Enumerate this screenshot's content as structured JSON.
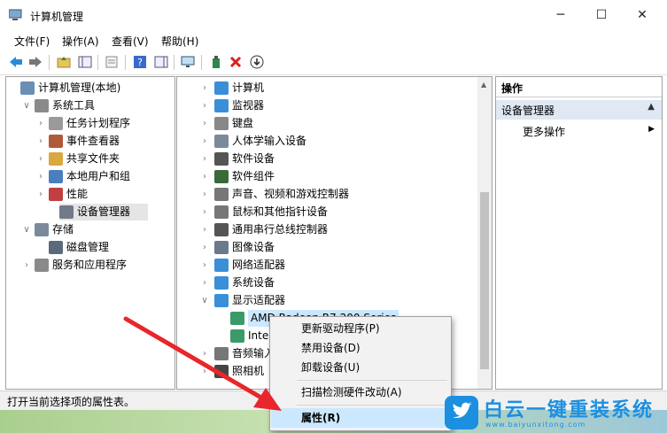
{
  "window": {
    "title": "计算机管理",
    "minimize": "─",
    "maximize": "☐",
    "close": "✕"
  },
  "menus": [
    "文件(F)",
    "操作(A)",
    "查看(V)",
    "帮助(H)"
  ],
  "toolbar": {
    "icons": [
      "back-icon",
      "forward-icon",
      "up-folder-icon",
      "show-tree-icon",
      "properties-icon",
      "help-icon",
      "show-pane-icon",
      "monitor-icon",
      "scan-hardware-icon",
      "delete-icon",
      "download-icon"
    ]
  },
  "tree": [
    {
      "label": "计算机管理(本地)",
      "level": 0,
      "expander": "",
      "icon": "computer-management-icon",
      "color": "#6a8fb5"
    },
    {
      "label": "系统工具",
      "level": 1,
      "expander": "∨",
      "icon": "tools-icon",
      "color": "#8a8a8a"
    },
    {
      "label": "任务计划程序",
      "level": 2,
      "expander": "›",
      "icon": "clock-icon",
      "color": "#9a9a9a"
    },
    {
      "label": "事件查看器",
      "level": 2,
      "expander": "›",
      "icon": "event-viewer-icon",
      "color": "#b05a3a"
    },
    {
      "label": "共享文件夹",
      "level": 2,
      "expander": "›",
      "icon": "shared-folder-icon",
      "color": "#d9a841"
    },
    {
      "label": "本地用户和组",
      "level": 2,
      "expander": "›",
      "icon": "users-icon",
      "color": "#4a7fbf"
    },
    {
      "label": "性能",
      "level": 2,
      "expander": "›",
      "icon": "performance-icon",
      "color": "#c04040"
    },
    {
      "label": "设备管理器",
      "level": 2,
      "expander": "",
      "icon": "device-manager-icon",
      "color": "#707a88",
      "selected": true
    },
    {
      "label": "存储",
      "level": 1,
      "expander": "∨",
      "icon": "storage-icon",
      "color": "#7a8a9a"
    },
    {
      "label": "磁盘管理",
      "level": 2,
      "expander": "",
      "icon": "disk-icon",
      "color": "#5a6a7a"
    },
    {
      "label": "服务和应用程序",
      "level": 1,
      "expander": "›",
      "icon": "services-icon",
      "color": "#8a8a8a"
    }
  ],
  "devices": [
    {
      "label": "计算机",
      "expander": "›",
      "icon": "computer-icon",
      "color": "#3a8fd8",
      "indent": 0
    },
    {
      "label": "监视器",
      "expander": "›",
      "icon": "monitor-icon",
      "color": "#3a8fd8",
      "indent": 0
    },
    {
      "label": "键盘",
      "expander": "›",
      "icon": "keyboard-icon",
      "color": "#888",
      "indent": 0
    },
    {
      "label": "人体学输入设备",
      "expander": "›",
      "icon": "hid-icon",
      "color": "#7a8a9a",
      "indent": 0
    },
    {
      "label": "软件设备",
      "expander": "›",
      "icon": "software-device-icon",
      "color": "#555",
      "indent": 0
    },
    {
      "label": "软件组件",
      "expander": "›",
      "icon": "software-component-icon",
      "color": "#3a6a3a",
      "indent": 0
    },
    {
      "label": "声音、视频和游戏控制器",
      "expander": "›",
      "icon": "speaker-icon",
      "color": "#777",
      "indent": 0
    },
    {
      "label": "鼠标和其他指针设备",
      "expander": "›",
      "icon": "mouse-icon",
      "color": "#777",
      "indent": 0
    },
    {
      "label": "通用串行总线控制器",
      "expander": "›",
      "icon": "usb-icon",
      "color": "#555",
      "indent": 0
    },
    {
      "label": "图像设备",
      "expander": "›",
      "icon": "camera-icon",
      "color": "#6a7a8a",
      "indent": 0
    },
    {
      "label": "网络适配器",
      "expander": "›",
      "icon": "network-icon",
      "color": "#3a8fd8",
      "indent": 0
    },
    {
      "label": "系统设备",
      "expander": "›",
      "icon": "system-device-icon",
      "color": "#3a8fd8",
      "indent": 0
    },
    {
      "label": "显示适配器",
      "expander": "∨",
      "icon": "display-adapter-icon",
      "color": "#3a8fd8",
      "indent": 0
    },
    {
      "label": "AMD Radeon R7 200 Series",
      "expander": "",
      "icon": "display-adapter-icon",
      "color": "#3a9a6a",
      "indent": 1,
      "selected": true
    },
    {
      "label": "Inte",
      "expander": "",
      "icon": "display-adapter-icon",
      "color": "#3a9a6a",
      "indent": 1
    },
    {
      "label": "音频输入",
      "expander": "›",
      "icon": "audio-io-icon",
      "color": "#777",
      "indent": 0
    },
    {
      "label": "照相机",
      "expander": "›",
      "icon": "webcam-icon",
      "color": "#444",
      "indent": 0
    }
  ],
  "actions": {
    "header": "操作",
    "section": "设备管理器",
    "more": "更多操作",
    "more_arrow": "▶"
  },
  "context_menu": {
    "items": [
      "更新驱动程序(P)",
      "禁用设备(D)",
      "卸载设备(U)"
    ],
    "scan": "扫描检测硬件改动(A)",
    "properties": "属性(R)"
  },
  "status": "打开当前选择项的属性表。",
  "watermark": {
    "text": "白云一键重装系统",
    "url": "www.baiyunxitong.com"
  },
  "colors": {
    "arrow": "#e8262b",
    "selection": "#cce8ff",
    "actions_header": "#dfe8f3",
    "brand_blue": "#1d8fe0"
  }
}
